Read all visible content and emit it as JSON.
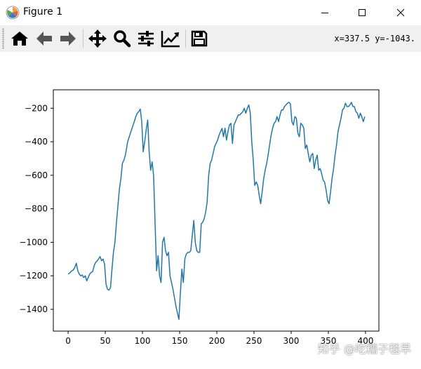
{
  "window": {
    "title": "Figure 1",
    "controls": [
      "minimize",
      "maximize",
      "close"
    ]
  },
  "toolbar": {
    "buttons": [
      {
        "name": "home",
        "icon": "home-icon"
      },
      {
        "name": "back",
        "icon": "arrow-left-icon"
      },
      {
        "name": "forward",
        "icon": "arrow-right-icon"
      },
      {
        "name": "pan",
        "icon": "move-icon"
      },
      {
        "name": "zoom",
        "icon": "magnifier-icon"
      },
      {
        "name": "subplots",
        "icon": "sliders-icon"
      },
      {
        "name": "customize",
        "icon": "line-chart-icon"
      },
      {
        "name": "save",
        "icon": "floppy-disk-icon"
      }
    ],
    "coords": "x=337.5 y=-1043."
  },
  "watermark": "知乎 @吃糯子毯早",
  "colors": {
    "line": "#1f77b4",
    "toolbar_bg": "#f0f0f0",
    "axes_edge": "#000000"
  },
  "chart_data": {
    "type": "line",
    "xlim": [
      -19.9,
      418
    ],
    "ylim": [
      -1530,
      -90
    ],
    "x_ticks": [
      0,
      50,
      100,
      150,
      200,
      250,
      300,
      350,
      400
    ],
    "y_ticks": [
      -1400,
      -1200,
      -1000,
      -800,
      -600,
      -400,
      -200
    ],
    "grid": false,
    "series": [
      {
        "x": [
          0,
          3,
          5,
          7,
          9,
          11,
          13,
          15,
          17,
          19,
          21,
          23,
          25,
          27,
          29,
          31,
          33,
          35,
          37,
          39,
          41,
          43,
          45,
          47,
          49,
          51,
          53,
          55,
          57,
          59,
          61,
          63,
          65,
          67,
          69,
          71,
          73,
          75,
          77,
          80,
          83,
          86,
          89,
          91,
          93,
          95,
          97,
          99,
          101,
          103,
          105,
          107,
          109,
          111,
          113,
          115,
          117,
          119,
          121,
          123,
          125,
          127,
          129,
          131,
          133,
          135,
          137,
          139,
          141,
          143,
          145,
          147,
          149,
          151,
          153,
          155,
          157,
          159,
          161,
          163,
          165,
          167,
          169,
          171,
          173,
          175,
          177,
          179,
          181,
          183,
          185,
          187,
          189,
          191,
          193,
          195,
          197,
          199,
          201,
          203,
          205,
          207,
          209,
          211,
          213,
          215,
          217,
          219,
          221,
          223,
          225,
          227,
          229,
          231,
          233,
          235,
          237,
          239,
          241,
          243,
          245,
          247,
          249,
          251,
          253,
          255,
          257,
          259,
          261,
          263,
          265,
          267,
          269,
          271,
          273,
          275,
          277,
          279,
          281,
          283,
          285,
          287,
          289,
          291,
          293,
          295,
          297,
          299,
          301,
          303,
          305,
          307,
          309,
          311,
          313,
          315,
          317,
          319,
          321,
          323,
          325,
          327,
          329,
          331,
          333,
          335,
          337,
          339,
          341,
          343,
          345,
          347,
          349,
          351,
          353,
          355,
          357,
          359,
          361,
          363,
          365,
          367,
          369,
          371,
          373,
          375,
          377,
          379,
          381,
          383,
          385,
          387,
          389,
          391,
          393,
          395,
          397,
          399
        ],
        "y": [
          -1190,
          -1180,
          -1170,
          -1165,
          -1150,
          -1125,
          -1170,
          -1190,
          -1200,
          -1195,
          -1210,
          -1200,
          -1230,
          -1210,
          -1190,
          -1180,
          -1175,
          -1140,
          -1120,
          -1110,
          -1100,
          -1085,
          -1110,
          -1100,
          -1130,
          -1250,
          -1280,
          -1285,
          -1270,
          -1160,
          -1060,
          -1000,
          -880,
          -780,
          -680,
          -620,
          -530,
          -510,
          -480,
          -400,
          -360,
          -320,
          -280,
          -250,
          -230,
          -220,
          -205,
          -280,
          -460,
          -400,
          -330,
          -270,
          -460,
          -570,
          -520,
          -600,
          -900,
          -1170,
          -1080,
          -1200,
          -1240,
          -1000,
          -970,
          -1050,
          -1080,
          -1060,
          -1200,
          -1240,
          -1280,
          -1330,
          -1380,
          -1420,
          -1460,
          -1300,
          -1160,
          -1240,
          -1100,
          -1070,
          -1060,
          -1060,
          -1050,
          -960,
          -870,
          -1000,
          -1050,
          -1060,
          -1060,
          -890,
          -880,
          -860,
          -820,
          -760,
          -600,
          -530,
          -510,
          -470,
          -430,
          -410,
          -390,
          -360,
          -340,
          -320,
          -370,
          -320,
          -390,
          -340,
          -300,
          -290,
          -410,
          -300,
          -280,
          -260,
          -240,
          -240,
          -230,
          -220,
          -200,
          -230,
          -200,
          -180,
          -230,
          -400,
          -510,
          -660,
          -640,
          -660,
          -720,
          -770,
          -700,
          -620,
          -570,
          -530,
          -480,
          -420,
          -360,
          -320,
          -290,
          -280,
          -250,
          -280,
          -240,
          -210,
          -210,
          -190,
          -180,
          -170,
          -165,
          -175,
          -280,
          -300,
          -250,
          -260,
          -350,
          -370,
          -290,
          -300,
          -320,
          -440,
          -420,
          -470,
          -520,
          -480,
          -470,
          -560,
          -510,
          -480,
          -570,
          -560,
          -590,
          -630,
          -640,
          -690,
          -750,
          -770,
          -700,
          -620,
          -560,
          -480,
          -420,
          -340,
          -300,
          -260,
          -210,
          -200,
          -170,
          -190,
          -190,
          -180,
          -165,
          -190,
          -190,
          -220,
          -230,
          -260,
          -230,
          -250,
          -280,
          -250
        ]
      }
    ]
  }
}
